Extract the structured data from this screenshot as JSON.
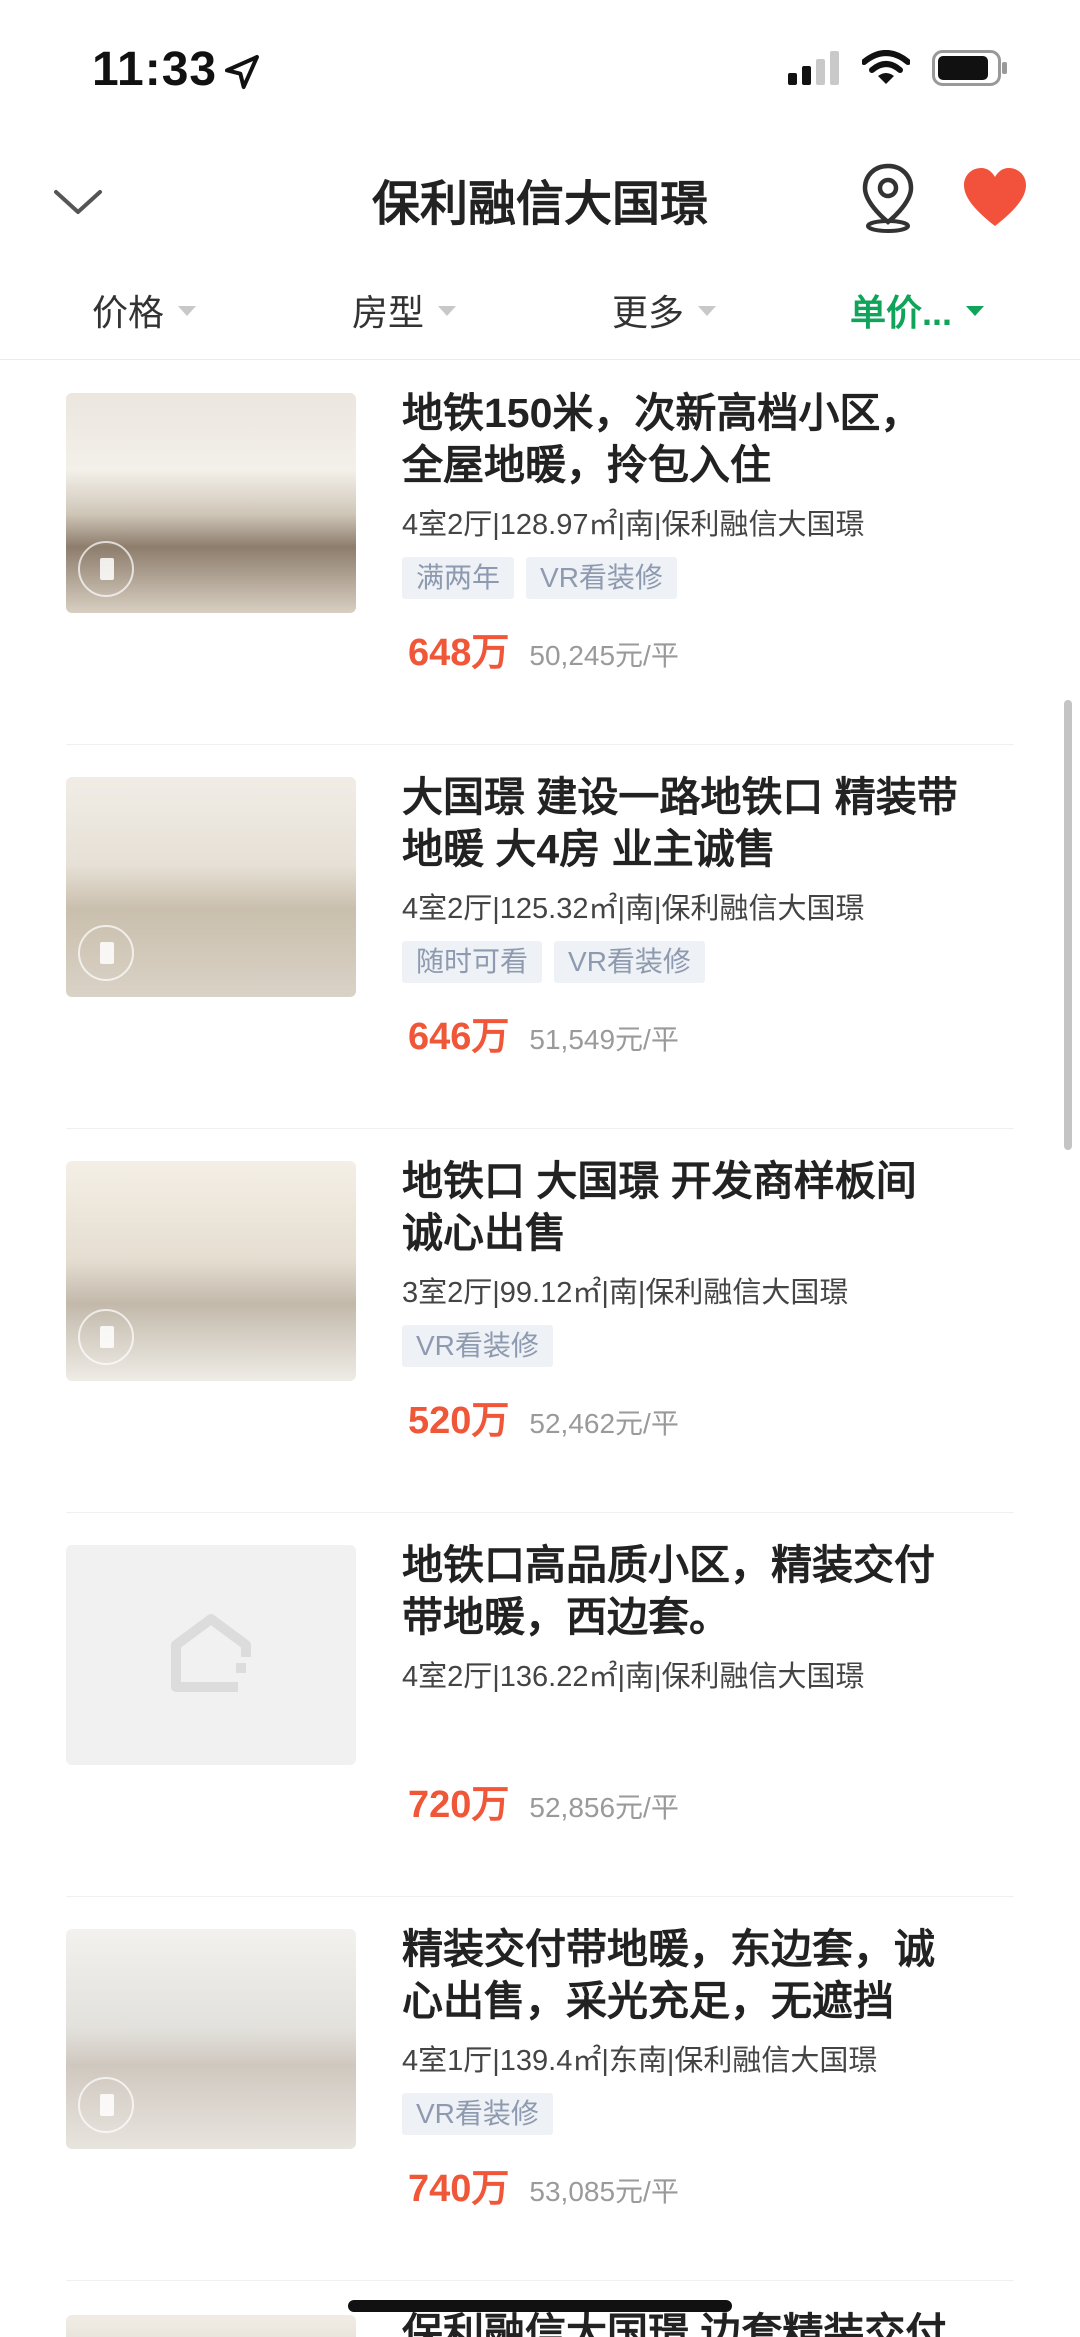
{
  "status_bar": {
    "time": "11:33"
  },
  "nav": {
    "title": "保利融信大国璟"
  },
  "filters": [
    {
      "label": "价格",
      "active": false
    },
    {
      "label": "房型",
      "active": false
    },
    {
      "label": "更多",
      "active": false
    },
    {
      "label": "单价...",
      "active": true
    }
  ],
  "listings": [
    {
      "title_line1": "地铁150米，次新高档小区，",
      "title_line2": "全屋地暖，拎包入住",
      "meta": "4室2厅|128.97㎡|南|保利融信大国璟",
      "tags": [
        "满两年",
        "VR看装修"
      ],
      "price": "648万",
      "unit_price": "50,245元/平"
    },
    {
      "title_line1": "大国璟 建设一路地铁口 精装带",
      "title_line2": "地暖 大4房 业主诚售",
      "meta": "4室2厅|125.32㎡|南|保利融信大国璟",
      "tags": [
        "随时可看",
        "VR看装修"
      ],
      "price": "646万",
      "unit_price": "51,549元/平"
    },
    {
      "title_line1": "地铁口 大国璟 开发商样板间",
      "title_line2": "诚心出售",
      "meta": "3室2厅|99.12㎡|南|保利融信大国璟",
      "tags": [
        "VR看装修"
      ],
      "price": "520万",
      "unit_price": "52,462元/平"
    },
    {
      "title_line1": "地铁口高品质小区，精装交付",
      "title_line2": "带地暖，西边套。",
      "meta": "4室2厅|136.22㎡|南|保利融信大国璟",
      "tags": [],
      "price": "720万",
      "unit_price": "52,856元/平"
    },
    {
      "title_line1": "精装交付带地暖，东边套，诚",
      "title_line2": "心出售，采光充足，无遮挡",
      "meta": "4室1厅|139.4㎡|东南|保利融信大国璟",
      "tags": [
        "VR看装修"
      ],
      "price": "740万",
      "unit_price": "53,085元/平"
    },
    {
      "title_line1": "保利融信大国璟 边套精装交付",
      "title_line2": "",
      "meta": "",
      "tags": [],
      "price": "",
      "unit_price": ""
    }
  ]
}
